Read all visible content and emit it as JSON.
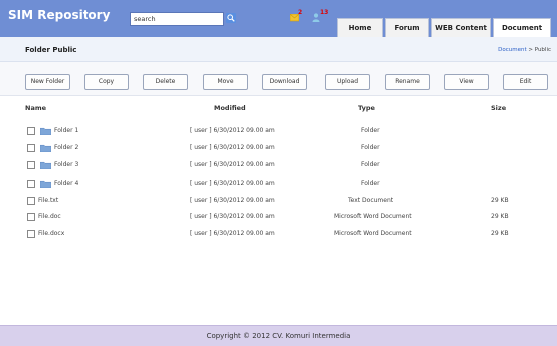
{
  "header": {
    "brand": "SIM Repository",
    "search_value": "search",
    "mail_count": "2",
    "user_count": "13",
    "tabs": [
      "Home",
      "Forum",
      "WEB Content",
      "Document"
    ],
    "active_tab": "Document"
  },
  "titlebar": {
    "title": "Folder Public",
    "breadcrumb_link": "Document",
    "breadcrumb_sep": " > ",
    "breadcrumb_current": "Public"
  },
  "toolbar": {
    "buttons": [
      "New Folder",
      "Copy",
      "Delete",
      "Move",
      "Download",
      "Upload",
      "Rename",
      "View",
      "Edit"
    ]
  },
  "table": {
    "headers": [
      "Name",
      "Modified",
      "Type",
      "Size"
    ],
    "rows": [
      {
        "name": "Folder 1",
        "modified": "[ user ] 6/30/2012  09.00 am",
        "type": "Folder",
        "size": ""
      },
      {
        "name": "Folder 2",
        "modified": "[ user ] 6/30/2012  09.00 am",
        "type": "Folder",
        "size": ""
      },
      {
        "name": "Folder 3",
        "modified": "[ user ] 6/30/2012  09.00 am",
        "type": "Folder",
        "size": ""
      },
      {
        "name": "Folder 4",
        "modified": "[ user ] 6/30/2012  09.00 am",
        "type": "Folder",
        "size": ""
      },
      {
        "name": "File.txt",
        "modified": "[ user ] 6/30/2012  09.00 am",
        "type": "Text Document",
        "size": "29 KB"
      },
      {
        "name": "File.doc",
        "modified": "[ user ] 6/30/2012  09.00 am",
        "type": "Microsoft Word Document",
        "size": "29 KB"
      },
      {
        "name": "File.docx",
        "modified": "[ user ] 6/30/2012  09.00 am",
        "type": "Microsoft Word Document",
        "size": "29 KB"
      }
    ]
  },
  "footer": {
    "copyright": "Copyright © 2012 CV. Komuri Intermedia"
  },
  "colors": {
    "header_bg": "#6f8ed4",
    "footer_bg": "#d8d0ec",
    "link": "#2b5fc6",
    "folder_icon": "#7ea6d8"
  },
  "icons": [
    "search-icon",
    "mail-icon",
    "user-icon",
    "folder-icon",
    "checkbox"
  ]
}
